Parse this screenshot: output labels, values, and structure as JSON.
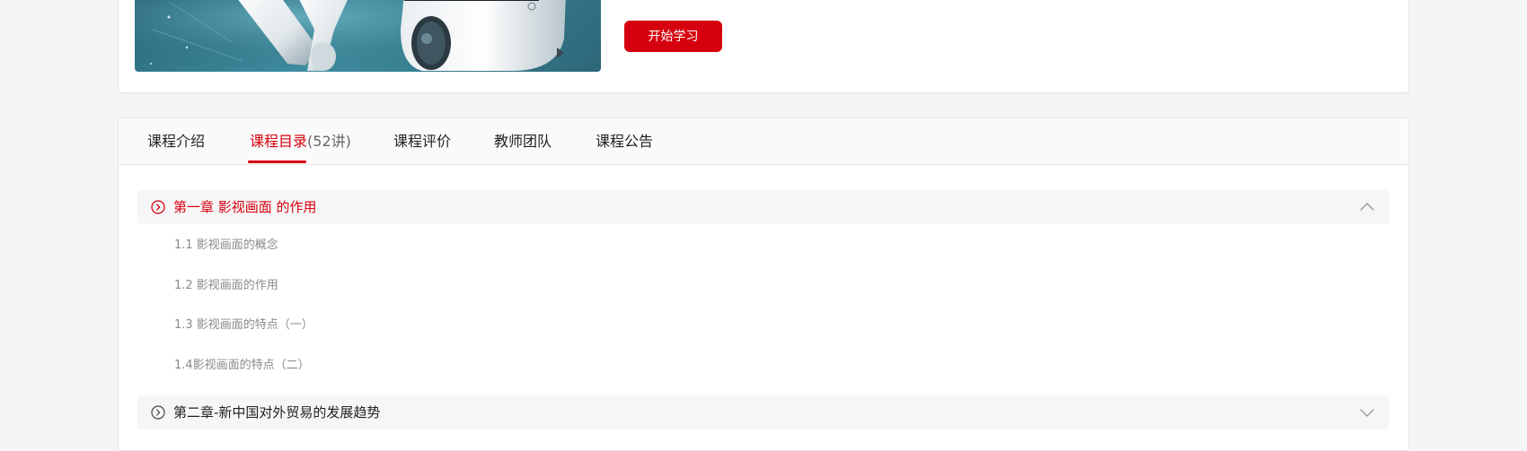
{
  "course": {
    "start_button": "开始学习"
  },
  "tabs": [
    {
      "label": "课程介绍",
      "count": ""
    },
    {
      "label": "课程目录",
      "count": "(52讲)"
    },
    {
      "label": "课程评价",
      "count": ""
    },
    {
      "label": "教师团队",
      "count": ""
    },
    {
      "label": "课程公告",
      "count": ""
    }
  ],
  "active_tab": "课程目录",
  "chapters": [
    {
      "title": "第一章 影视画面 的作用",
      "expanded": true,
      "lessons": [
        "1.1 影视画面的概念",
        "1.2 影视画面的作用",
        "1.3 影视画面的特点（一）",
        "1.4影视画面的特点（二）"
      ]
    },
    {
      "title": "第二章-新中国对外贸易的发展趋势",
      "expanded": false,
      "lessons": []
    }
  ],
  "colors": {
    "accent": "#d6000f",
    "text": "#222222",
    "muted": "#8a8a8a",
    "chapter_bg": "#f6f6f6"
  },
  "icons": {
    "chapter": "circle-chevron-right-icon",
    "expanded": "chevron-up-icon",
    "collapsed": "chevron-down-icon"
  }
}
